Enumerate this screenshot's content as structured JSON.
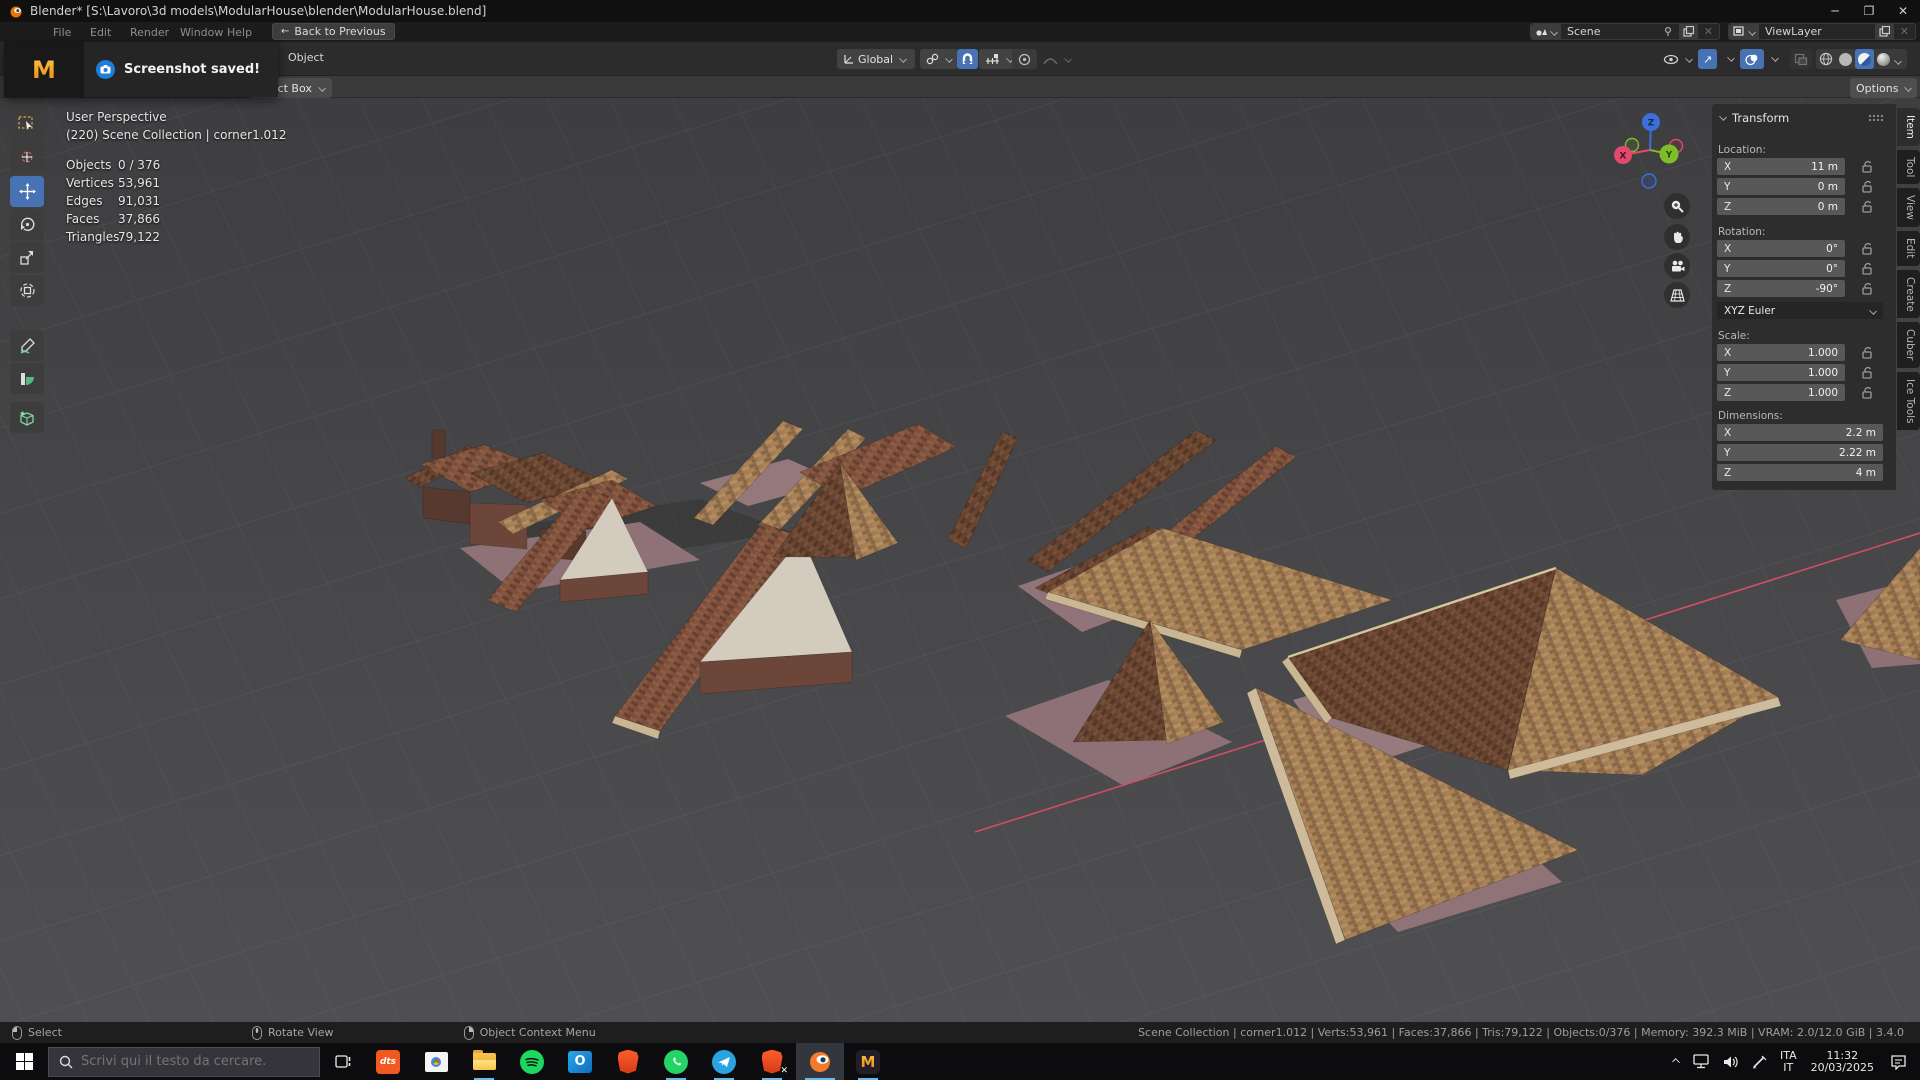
{
  "titlebar": {
    "title": "Blender* [S:\\Lavoro\\3d models\\ModularHouse\\blender\\ModularHouse.blend]"
  },
  "topbar": {
    "menus": [
      "File",
      "Edit",
      "Render",
      "Window",
      "Help"
    ],
    "back_button": "Back to Previous",
    "scene_field": "Scene",
    "viewlayer_field": "ViewLayer"
  },
  "toast": {
    "app_initial": "M",
    "message": "Screenshot saved!"
  },
  "header": {
    "object_menu": "Object",
    "orientation": "Global",
    "tool_button": "Select Box",
    "options_button": "Options"
  },
  "viewport": {
    "view_label": "User Perspective",
    "breadcrumb": "(220) Scene Collection | corner1.012",
    "stats": [
      {
        "label": "Objects",
        "value": "0 / 376"
      },
      {
        "label": "Vertices",
        "value": "53,961"
      },
      {
        "label": "Edges",
        "value": "91,031"
      },
      {
        "label": "Faces",
        "value": "37,866"
      },
      {
        "label": "Triangles",
        "value": "79,122"
      }
    ]
  },
  "gizmo": {
    "x_label": "X",
    "y_label": "Y",
    "z_label": "Z"
  },
  "sidebar": {
    "panel_title": "Transform",
    "location_label": "Location:",
    "loc": [
      {
        "axis": "X",
        "value": "11 m"
      },
      {
        "axis": "Y",
        "value": "0 m"
      },
      {
        "axis": "Z",
        "value": "0 m"
      }
    ],
    "rotation_label": "Rotation:",
    "rot": [
      {
        "axis": "X",
        "value": "0°"
      },
      {
        "axis": "Y",
        "value": "0°"
      },
      {
        "axis": "Z",
        "value": "-90°"
      }
    ],
    "rotation_mode": "XYZ Euler",
    "scale_label": "Scale:",
    "scl": [
      {
        "axis": "X",
        "value": "1.000"
      },
      {
        "axis": "Y",
        "value": "1.000"
      },
      {
        "axis": "Z",
        "value": "1.000"
      }
    ],
    "dimensions_label": "Dimensions:",
    "dim": [
      {
        "axis": "X",
        "value": "2.2 m"
      },
      {
        "axis": "Y",
        "value": "2.22 m"
      },
      {
        "axis": "Z",
        "value": "4 m"
      }
    ],
    "tabs": [
      "Item",
      "Tool",
      "View",
      "Edit",
      "Create",
      "Cuber",
      "Ice Tools"
    ],
    "active_tab": "Item"
  },
  "statusbar": {
    "hints": [
      {
        "label": "Select"
      },
      {
        "label": "Rotate View"
      },
      {
        "label": "Object Context Menu"
      }
    ],
    "info": "Scene Collection | corner1.012 | Verts:53,961 | Faces:37,866 | Tris:79,122 | Objects:0/376 | Memory: 392.3 MiB | VRAM: 2.0/12.0 GiB | 3.4.0"
  },
  "taskbar": {
    "search_placeholder": "Scrivi qui il testo da cercare.",
    "dts_label": "dts",
    "outlook_label": "O",
    "m_label": "M",
    "tray": {
      "lang_line1": "ITA",
      "lang_line2": "IT",
      "time": "11:32",
      "date": "20/03/2025"
    }
  },
  "colors": {
    "accent_blue": "#4772b3",
    "axis_red": "#e24a6c",
    "axis_green": "#7fbc2a",
    "axis_blue": "#3d6fd8",
    "taskbar_underline": "#6cb8e8"
  }
}
